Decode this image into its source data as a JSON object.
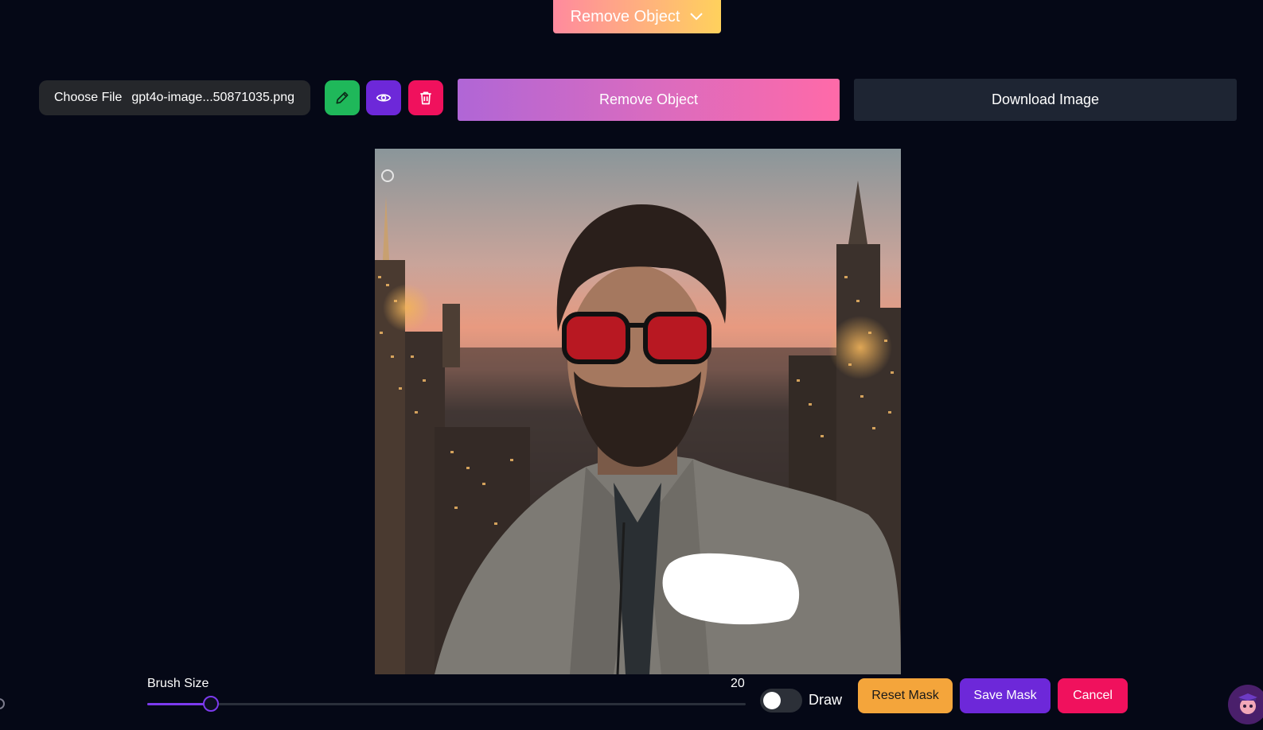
{
  "mode_dropdown": {
    "label": "Remove Object"
  },
  "toolbar": {
    "choose_file_label": "Choose File",
    "file_name": "gpt4o-image...50871035.png",
    "remove_label": "Remove Object",
    "download_label": "Download Image"
  },
  "editor": {
    "image_alt": "Portrait of a bearded man in red sunglasses and a grey fleece jacket in front of a city skyline at sunset, with a white painted mask on the chest"
  },
  "brush": {
    "label": "Brush Size",
    "value": "20",
    "value_fraction": 0.107
  },
  "mask_controls": {
    "draw_label": "Draw",
    "draw_enabled": false,
    "reset_label": "Reset Mask",
    "save_label": "Save Mask",
    "cancel_label": "Cancel"
  },
  "colors": {
    "background": "#050816",
    "accent_purple": "#6d28d9",
    "accent_pink": "#f0115d",
    "accent_green": "#1fb85a",
    "accent_orange": "#f4a53b"
  },
  "icons": [
    "chevron-down-icon",
    "pencil-icon",
    "eye-icon",
    "trash-icon",
    "mascot-icon"
  ]
}
